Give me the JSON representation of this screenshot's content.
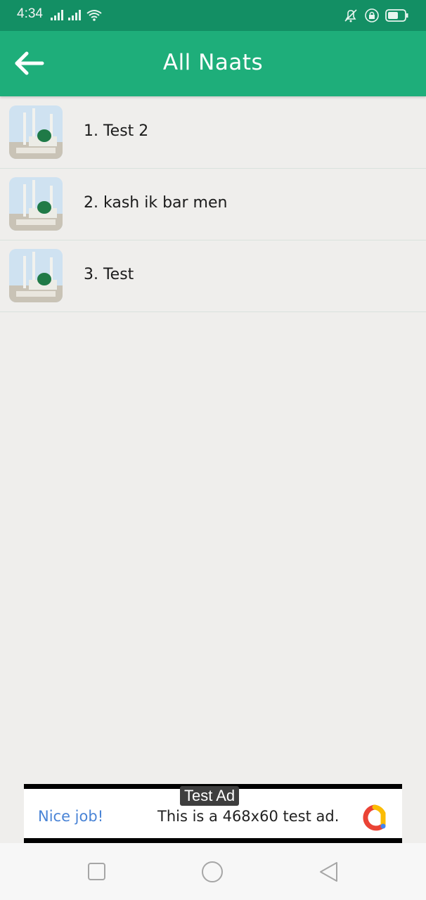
{
  "status_bar": {
    "time": "4:34",
    "icons": [
      "signal-icon",
      "signal-icon",
      "wifi-icon",
      "bell-off-icon",
      "lock-icon",
      "battery-icon"
    ]
  },
  "app_bar": {
    "title": "All Naats",
    "back_icon": "arrow-left-icon",
    "color": "#1eae7a"
  },
  "naats": [
    {
      "label": "1. Test 2"
    },
    {
      "label": "2. kash ik bar men"
    },
    {
      "label": "3. Test"
    }
  ],
  "ad": {
    "label": "Test Ad",
    "headline": "Nice job!",
    "body": "This is a 468x60 test ad."
  },
  "nav_bar": {
    "buttons": [
      "recents-square-icon",
      "home-circle-icon",
      "back-triangle-icon"
    ]
  }
}
